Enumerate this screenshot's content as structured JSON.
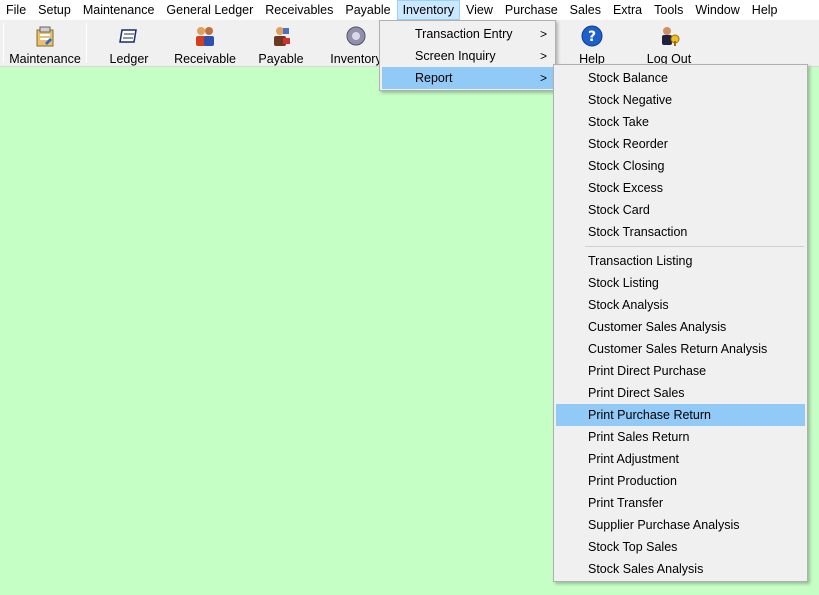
{
  "menubar": {
    "items": [
      "File",
      "Setup",
      "Maintenance",
      "General Ledger",
      "Receivables",
      "Payable",
      "Inventory",
      "View",
      "Purchase",
      "Sales",
      "Extra",
      "Tools",
      "Window",
      "Help"
    ],
    "open_item": "Inventory"
  },
  "toolbar": {
    "buttons": [
      {
        "label": "Maintenance",
        "icon": "maintenance-icon"
      },
      {
        "label": "Ledger",
        "icon": "ledger-icon"
      },
      {
        "label": "Receivable",
        "icon": "receivable-icon"
      },
      {
        "label": "Payable",
        "icon": "payable-icon"
      },
      {
        "label": "Inventory",
        "icon": "inventory-icon"
      },
      {
        "label": "Help",
        "icon": "help-icon"
      },
      {
        "label": "Log Out",
        "icon": "logout-icon"
      }
    ]
  },
  "inventory_menu": {
    "items": [
      {
        "label": "Transaction Entry",
        "has_submenu": true
      },
      {
        "label": "Screen Inquiry",
        "has_submenu": true
      },
      {
        "label": "Report",
        "has_submenu": true,
        "highlighted": true
      }
    ],
    "submenu_arrow": ">"
  },
  "report_menu": {
    "group1": [
      "Stock Balance",
      "Stock Negative",
      "Stock Take",
      "Stock Reorder",
      "Stock Closing",
      "Stock Excess",
      "Stock Card",
      "Stock Transaction"
    ],
    "group2": [
      "Transaction Listing",
      "Stock Listing",
      "Stock Analysis",
      "Customer Sales Analysis",
      "Customer Sales Return Analysis",
      "Print Direct Purchase",
      "Print Direct Sales",
      "Print Purchase Return",
      "Print Sales Return",
      "Print Adjustment",
      "Print Production",
      "Print Transfer",
      "Supplier Purchase Analysis",
      "Stock Top Sales",
      "Stock Sales Analysis"
    ],
    "highlighted": "Print Purchase Return"
  },
  "colors": {
    "background": "#c6ffc6",
    "menu_highlight": "#91c9f7",
    "menubar_open": "#cce8ff",
    "menu_bg": "#f0f0f0"
  }
}
